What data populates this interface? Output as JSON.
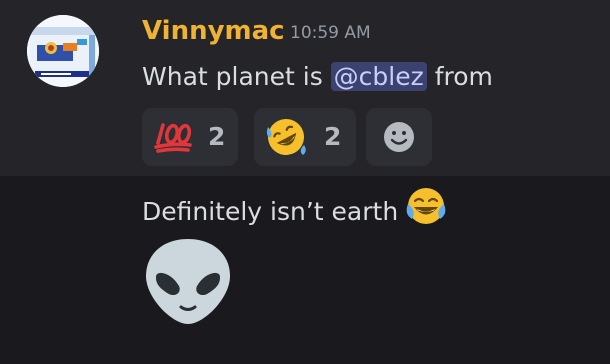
{
  "message_group": {
    "author": "Vinnymac",
    "timestamp": "10:59 AM",
    "message1": {
      "prefix": "What planet is ",
      "mention": "@cblez",
      "suffix": " from"
    },
    "reactions": [
      {
        "emoji": "100",
        "count": "2"
      },
      {
        "emoji": "rolling-on-floor-laughing",
        "count": "2"
      },
      {
        "emoji": "add-reaction"
      }
    ],
    "message2": {
      "text": "Definitely isn’t earth",
      "emoji": "joy"
    },
    "message3": {
      "emoji": "alien"
    }
  },
  "colors": {
    "background": "#1a1a1e",
    "hover_background": "#242429",
    "username": "#f0b232",
    "mention_bg": "#3c4270",
    "mention_text": "#c9cdfb",
    "reaction_bg": "#2e2f34"
  }
}
